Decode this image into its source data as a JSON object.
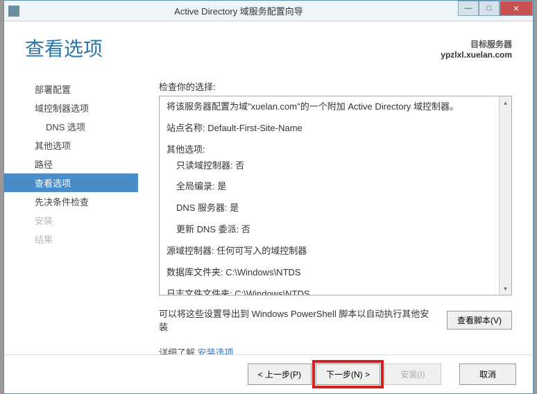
{
  "window": {
    "title": "Active Directory 域服务配置向导"
  },
  "header": {
    "page_title": "查看选项",
    "target_label": "目标服务器",
    "target_value": "ypzlxl.xuelan.com"
  },
  "sidebar": {
    "items": [
      {
        "label": "部署配置",
        "state": "normal"
      },
      {
        "label": "域控制器选项",
        "state": "normal"
      },
      {
        "label": "DNS 选项",
        "state": "normal",
        "indent": true
      },
      {
        "label": "其他选项",
        "state": "normal"
      },
      {
        "label": "路径",
        "state": "normal"
      },
      {
        "label": "查看选项",
        "state": "active"
      },
      {
        "label": "先决条件检查",
        "state": "normal"
      },
      {
        "label": "安装",
        "state": "disabled"
      },
      {
        "label": "结果",
        "state": "disabled"
      }
    ]
  },
  "review": {
    "label": "检查你的选择:",
    "lines": {
      "l0": "将该服务器配置为域\"xuelan.com\"的一个附加 Active Directory 域控制器。",
      "l1": "站点名称: Default-First-Site-Name",
      "l2": "其他选项:",
      "l3": "只读域控制器: 否",
      "l4": "全局编录: 是",
      "l5": "DNS 服务器: 是",
      "l6": "更新 DNS 委派: 否",
      "l7": "源域控制器: 任何可写入的域控制器",
      "l8": "数据库文件夹: C:\\Windows\\NTDS",
      "l9": "日志文件文件夹: C:\\Windows\\NTDS"
    }
  },
  "export": {
    "text": "可以将这些设置导出到 Windows PowerShell 脚本以自动执行其他安装",
    "button": "查看脚本(V)"
  },
  "learn_more": {
    "prefix": "详细了解",
    "link": "安装选项"
  },
  "footer": {
    "prev": "< 上一步(P)",
    "next": "下一步(N) >",
    "install": "安装(I)",
    "cancel": "取消"
  }
}
